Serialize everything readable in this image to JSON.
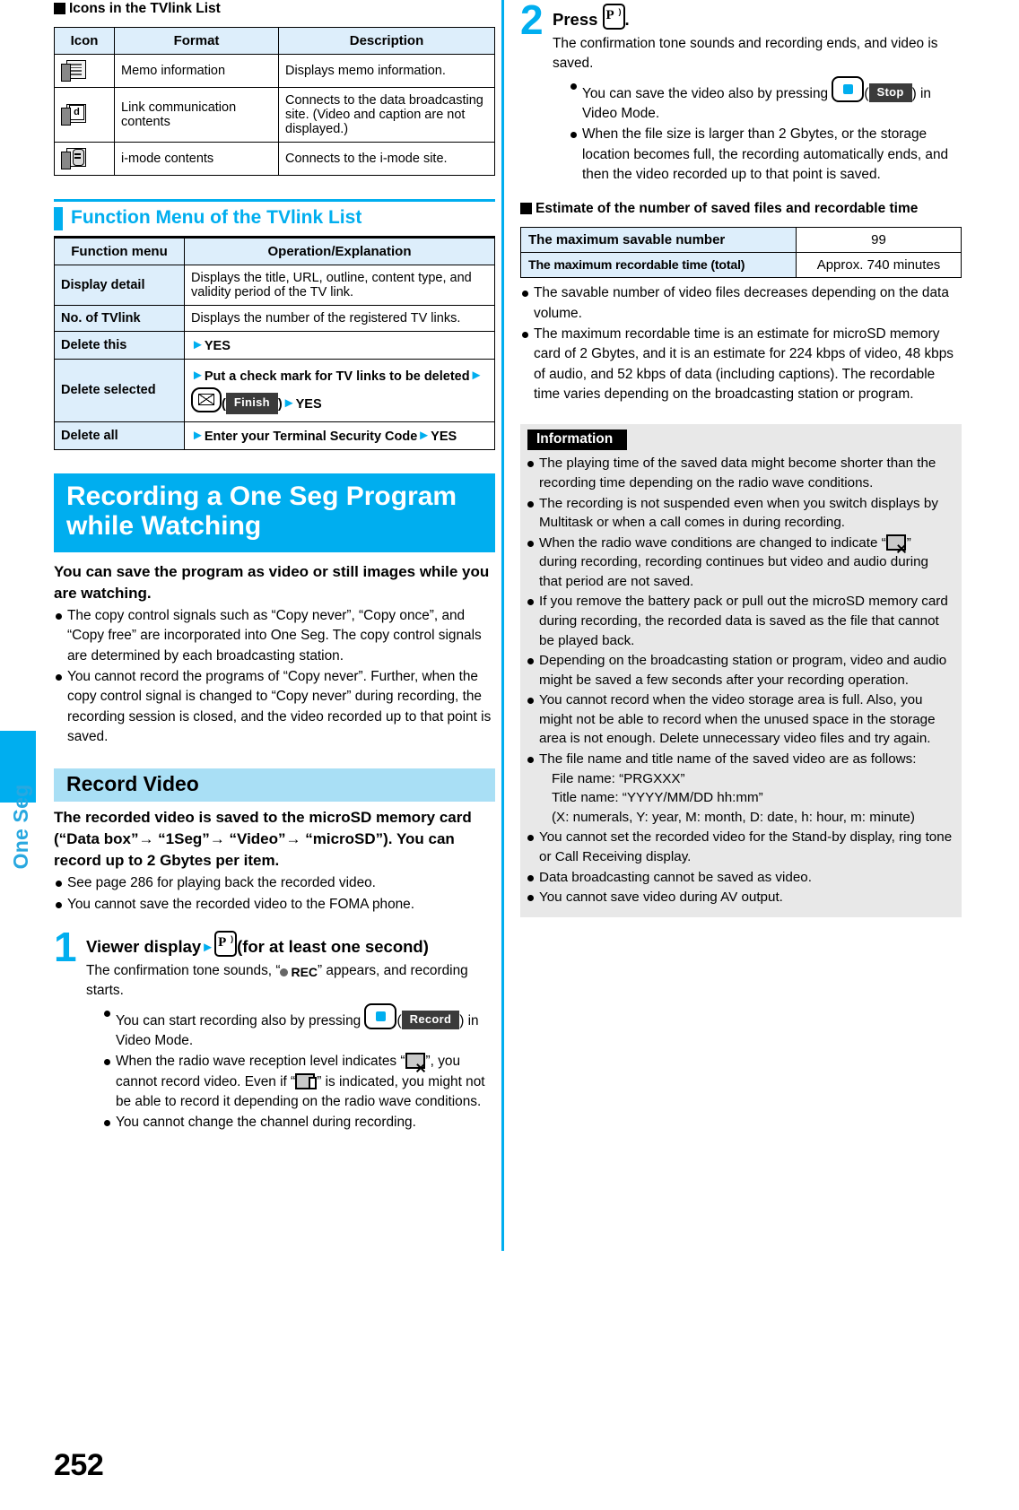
{
  "sidetab": {
    "label": "One Seg"
  },
  "page_number": "252",
  "left": {
    "icons_heading": "Icons in the TVlink List",
    "icons_table": {
      "headers": [
        "Icon",
        "Format",
        "Description"
      ],
      "rows": [
        {
          "icon": "memo-icon",
          "format": "Memo information",
          "description": "Displays memo information."
        },
        {
          "icon": "link-communication-icon",
          "format": "Link communication contents",
          "description": "Connects to the data broadcasting site. (Video and caption are not displayed.)"
        },
        {
          "icon": "i-mode-contents-icon",
          "format": "i-mode contents",
          "description": "Connects to the i-mode site."
        }
      ]
    },
    "function_menu_heading": "Function Menu of the TVlink List",
    "function_table": {
      "headers": [
        "Function menu",
        "Operation/Explanation"
      ],
      "rows": [
        {
          "menu": "Display detail",
          "op_plain": "Displays the title, URL, outline, content type, and validity period of the TV link."
        },
        {
          "menu": "No. of TVlink",
          "op_plain": "Displays the number of the registered TV links."
        },
        {
          "menu": "Delete this",
          "op_bold_1": "YES"
        },
        {
          "menu": "Delete selected",
          "op_bold_1": "Put a check mark for TV links to be deleted",
          "key": "mail-key",
          "softkey": "Finish",
          "op_bold_2": "YES"
        },
        {
          "menu": "Delete all",
          "op_bold_1": "Enter your Terminal Security Code",
          "op_bold_2": "YES"
        }
      ]
    },
    "chapter_title": "Recording a One Seg Program while Watching",
    "chapter_lead": "You can save the program as video or still images while you are watching.",
    "chapter_bullets": [
      "The copy control signals such as “Copy never”, “Copy once”, and “Copy free” are incorporated into One Seg. The copy control signals are determined by each broadcasting station.",
      "You cannot record the programs of “Copy never”. Further, when the copy control signal is changed to “Copy never” during recording, the recording session is closed, and the video recorded up to that point is saved."
    ],
    "section_title": "Record Video",
    "section_lead": "The recorded video is saved to the microSD memory card (“Data box”→ “1Seg”→ “Video”→ “microSD”). You can record up to 2 Gbytes per item.",
    "section_bullets": [
      "See page 286 for playing back the recorded video.",
      "You cannot save the recorded video to the FOMA phone."
    ],
    "step1": {
      "number": "1",
      "title_pre": "Viewer display",
      "title_post": "(for at least one second)",
      "desc_pre": "The confirmation tone sounds, “",
      "rec_label": "REC",
      "desc_post": "” appears, and recording starts.",
      "bullets": [
        {
          "pre": "You can start recording also by pressing ",
          "key": "center-key",
          "softkey": "Record",
          "post": ") in Video Mode."
        },
        {
          "pre": "When the radio wave reception level indicates “",
          "icon1": "no-signal-icon",
          "mid": "”, you cannot record video. Even if “",
          "icon2": "weak-signal-icon",
          "post": "” is indicated, you might not be able to record it depending on the radio wave conditions."
        },
        {
          "plain": "You cannot change the channel during recording."
        }
      ]
    }
  },
  "right": {
    "step2": {
      "number": "2",
      "title_pre": "Press",
      "title_post": ".",
      "desc": "The confirmation tone sounds and recording ends, and video is saved.",
      "bullets": [
        {
          "pre": "You can save the video also by pressing ",
          "key": "center-key",
          "softkey": "Stop",
          "post": ") in Video Mode."
        },
        {
          "plain": "When the file size is larger than 2 Gbytes, or the storage location becomes full, the recording automatically ends, and then the video recorded up to that point is saved."
        }
      ]
    },
    "estimate_heading": "Estimate of the number of saved files and recordable time",
    "estimate_table": {
      "rows": [
        {
          "label": "The maximum savable number",
          "value": "99"
        },
        {
          "label": "The maximum recordable time (total)",
          "value": "Approx. 740 minutes"
        }
      ]
    },
    "estimate_bullets": [
      "The savable number of video files decreases depending on the data volume.",
      "The maximum recordable time is an estimate for microSD memory card of 2 Gbytes, and it is an estimate for 224 kbps of video, 48 kbps of audio, and 52 kbps of data (including captions). The recordable time varies depending on the broadcasting station or program."
    ],
    "information": {
      "heading": "Information",
      "items": [
        {
          "plain": "The playing time of the saved data might become shorter than the recording time depending on the radio wave conditions."
        },
        {
          "plain": "The recording is not suspended even when you switch displays by Multitask or when a call comes in during recording."
        },
        {
          "pre": "When the radio wave conditions are changed to indicate “",
          "icon1": "no-signal-icon",
          "post": "” during recording, recording continues but video and audio during that period are not saved."
        },
        {
          "plain": "If you remove the battery pack or pull out the microSD memory card during recording, the recorded data is saved as the file that cannot be played back."
        },
        {
          "plain": "Depending on the broadcasting station or program, video and audio might be saved a few seconds after your recording operation."
        },
        {
          "plain": "You cannot record when the video storage area is full. Also, you might not be able to record when the unused space in the storage area is not enough. Delete unnecessary video files and try again."
        },
        {
          "plain": "The file name and title name of the saved video are as follows:",
          "lines": [
            "File name: “PRGXXX”",
            "Title name: “YYYY/MM/DD hh:mm”",
            "(X: numerals, Y: year, M: month, D: date, h: hour, m: minute)"
          ]
        },
        {
          "plain": "You cannot set the recorded video for the Stand-by display, ring tone or Call Receiving display."
        },
        {
          "plain": "Data broadcasting cannot be saved as video."
        },
        {
          "plain": "You cannot save video during AV output."
        }
      ]
    }
  },
  "colors": {
    "accent": "#00aeef",
    "table_header": "#ddeefb",
    "subbar": "#a9dff5",
    "info_bg": "#e8e8e8"
  }
}
